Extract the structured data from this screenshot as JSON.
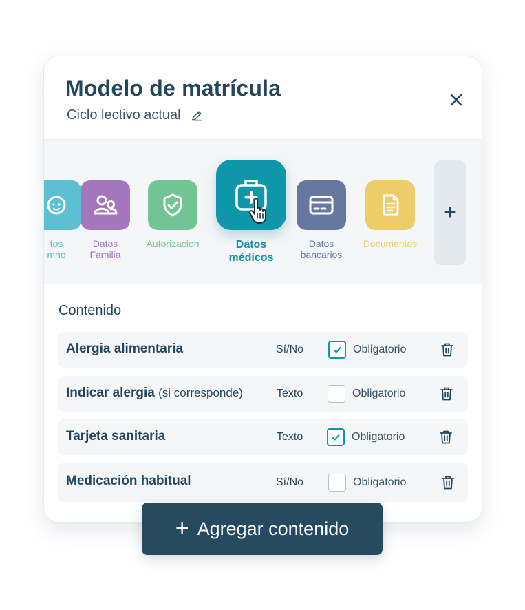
{
  "header": {
    "title": "Modelo de matrícula",
    "subtitle": "Ciclo lectivo actual"
  },
  "colors": {
    "primary": "#264a60",
    "accent_teal": "#0f96a9",
    "student_blue": "#5cbfd2",
    "family_purple": "#a476bd",
    "authorization_green": "#72c495",
    "bank_slate": "#66789f",
    "documents_yellow": "#eccd6a"
  },
  "tabs": [
    {
      "label_line1": "tos",
      "label_line2": "mno",
      "icon": "student-face-icon",
      "color": "#5cbfd2"
    },
    {
      "label_line1": "Datos",
      "label_line2": "Familia",
      "icon": "family-icon",
      "color": "#a476bd"
    },
    {
      "label_line1": "Autorizacion",
      "label_line2": "",
      "icon": "shield-check-icon",
      "color": "#72c495"
    },
    {
      "label_line1": "Datos",
      "label_line2": "médicos",
      "icon": "medical-kit-icon",
      "color": "#0f96a9",
      "active": true
    },
    {
      "label_line1": "Datos",
      "label_line2": "bancarios",
      "icon": "credit-card-icon",
      "color": "#66789f"
    },
    {
      "label_line1": "Documentos",
      "label_line2": "",
      "icon": "document-icon",
      "color": "#eccd6a"
    }
  ],
  "add_tab_symbol": "+",
  "content": {
    "title": "Contenido",
    "rows": [
      {
        "name": "Alergia alimentaria",
        "hint": "",
        "type": "Sí/No",
        "required_label": "Obligatorio",
        "required": true
      },
      {
        "name": "Indicar alergia",
        "hint": "(si corresponde)",
        "type": "Texto",
        "required_label": "Obligatorio",
        "required": false
      },
      {
        "name": "Tarjeta sanitaria",
        "hint": "",
        "type": "Texto",
        "required_label": "Obligatorio",
        "required": true
      },
      {
        "name": "Medicación habitual",
        "hint": "",
        "type": "Sí/No",
        "required_label": "Obligatorio",
        "required": false
      }
    ]
  },
  "add_button": {
    "symbol": "+",
    "label": "Agregar contenido"
  }
}
